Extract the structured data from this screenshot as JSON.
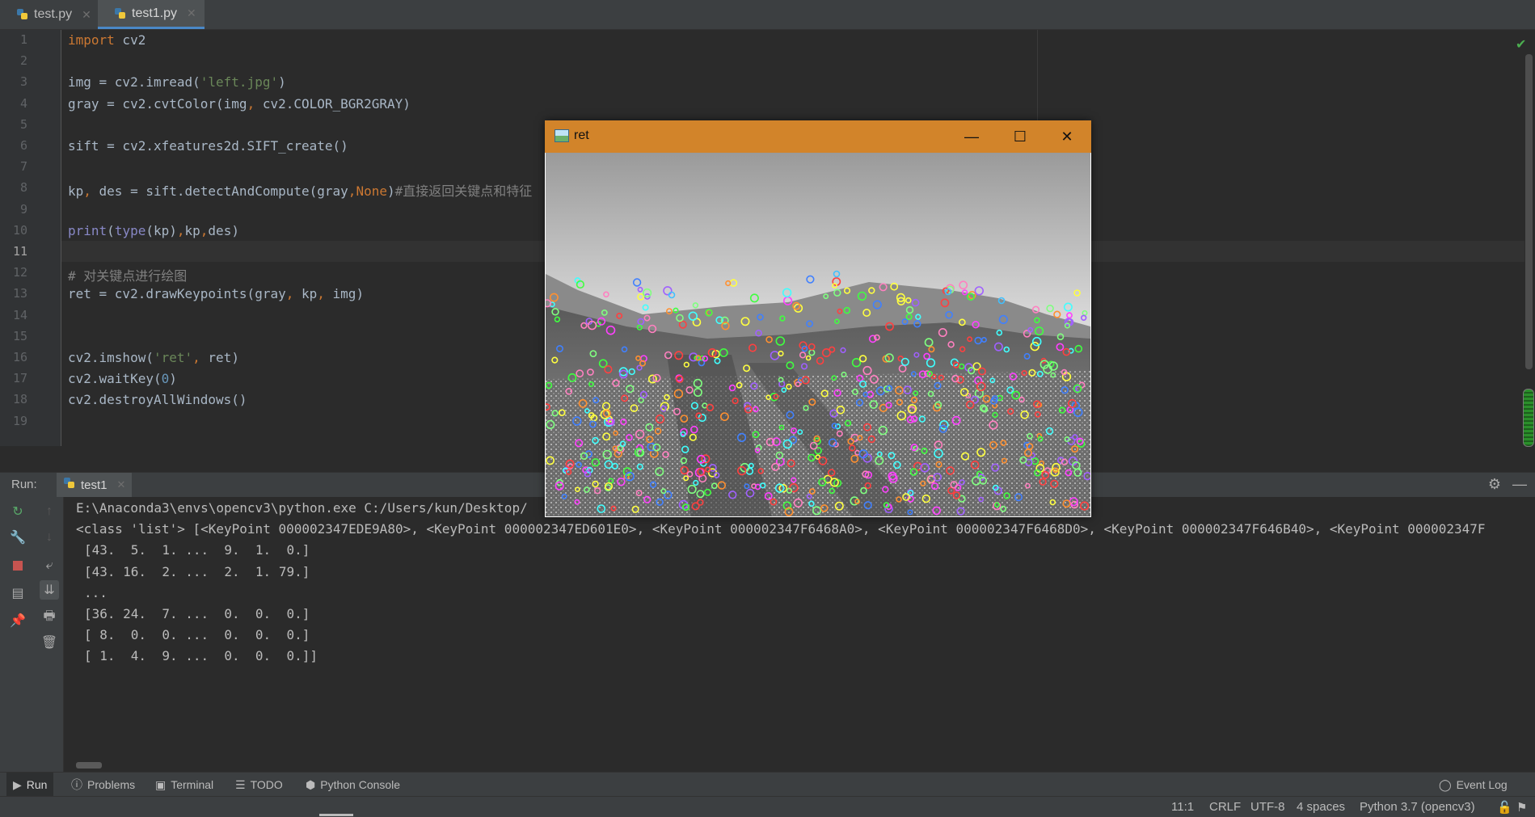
{
  "tabs": [
    {
      "label": "test.py",
      "active": false
    },
    {
      "label": "test1.py",
      "active": true
    }
  ],
  "editor": {
    "current_line": 11,
    "lines": [
      [
        {
          "t": "import",
          "c": "kw"
        },
        {
          "t": " cv2",
          "c": ""
        }
      ],
      [],
      [
        {
          "t": "img = cv2.imread(",
          "c": ""
        },
        {
          "t": "'left.jpg'",
          "c": "str"
        },
        {
          "t": ")",
          "c": ""
        }
      ],
      [
        {
          "t": "gray = cv2.cvtColor(img",
          "c": ""
        },
        {
          "t": ",",
          "c": "kw"
        },
        {
          "t": " cv2.COLOR_BGR2GRAY)",
          "c": ""
        }
      ],
      [],
      [
        {
          "t": "sift = cv2.xfeatures2d.SIFT_create()",
          "c": ""
        }
      ],
      [],
      [
        {
          "t": "kp",
          "c": ""
        },
        {
          "t": ",",
          "c": "kw"
        },
        {
          "t": " des = sift.detectAndCompute(gray",
          "c": ""
        },
        {
          "t": ",",
          "c": "kw"
        },
        {
          "t": "None",
          "c": "kw"
        },
        {
          "t": ")",
          "c": ""
        },
        {
          "t": "#直接返回关键点和特征",
          "c": "cm"
        }
      ],
      [],
      [
        {
          "t": "print",
          "c": "bi"
        },
        {
          "t": "(",
          "c": ""
        },
        {
          "t": "type",
          "c": "bi"
        },
        {
          "t": "(kp)",
          "c": ""
        },
        {
          "t": ",",
          "c": "kw"
        },
        {
          "t": "kp",
          "c": ""
        },
        {
          "t": ",",
          "c": "kw"
        },
        {
          "t": "des)",
          "c": ""
        }
      ],
      [],
      [
        {
          "t": "# 对关键点进行绘图",
          "c": "cm"
        }
      ],
      [
        {
          "t": "ret = cv2.drawKeypoints(gray",
          "c": ""
        },
        {
          "t": ",",
          "c": "kw"
        },
        {
          "t": " kp",
          "c": ""
        },
        {
          "t": ",",
          "c": "kw"
        },
        {
          "t": " img)",
          "c": ""
        }
      ],
      [],
      [],
      [
        {
          "t": "cv2.imshow(",
          "c": ""
        },
        {
          "t": "'ret'",
          "c": "str"
        },
        {
          "t": ",",
          "c": "kw"
        },
        {
          "t": " ret)",
          "c": ""
        }
      ],
      [
        {
          "t": "cv2.waitKey(",
          "c": ""
        },
        {
          "t": "0",
          "c": "num"
        },
        {
          "t": ")",
          "c": ""
        }
      ],
      [
        {
          "t": "cv2.destroyAllWindows()",
          "c": ""
        }
      ],
      []
    ]
  },
  "run": {
    "label": "Run:",
    "tab": "test1",
    "output": [
      "E:\\Anaconda3\\envs\\opencv3\\python.exe C:/Users/kun/Desktop/",
      "<class 'list'> [<KeyPoint 000002347EDE9A80>, <KeyPoint 000002347ED601E0>, <KeyPoint 000002347F6468A0>, <KeyPoint 000002347F6468D0>, <KeyPoint 000002347F646B40>, <KeyPoint 000002347F",
      "[43.  5.  1. ...  9.  1.  0.]",
      "[43. 16.  2. ...  2.  1. 79.]",
      "...",
      "[36. 24.  7. ...  0.  0.  0.]",
      "[ 8.  0.  0. ...  0.  0.  0.]",
      "[ 1.  4.  9. ...  0.  0.  0.]]"
    ]
  },
  "tool_windows": [
    "Run",
    "Problems",
    "Terminal",
    "TODO",
    "Python Console"
  ],
  "event_log": "Event Log",
  "status": {
    "position": "11:1",
    "line_sep": "CRLF",
    "encoding": "UTF-8",
    "indent": "4 spaces",
    "interpreter": "Python 3.7 (opencv3)"
  },
  "image_window": {
    "title": "ret",
    "keypoint_colors": [
      "#ff4040",
      "#40ff40",
      "#4080ff",
      "#ffff40",
      "#ff40ff",
      "#40ffff",
      "#ff9030",
      "#a060ff",
      "#80ff80",
      "#ff80c0"
    ]
  },
  "icons": {
    "python": "python-file-icon",
    "rerun": "rerun-icon",
    "wrench": "wrench-icon",
    "stop": "stop-icon",
    "layout": "layout-icon",
    "pin": "pin-icon",
    "up": "arrow-up-icon",
    "down": "arrow-down-icon",
    "wrap": "soft-wrap-icon",
    "scroll": "scroll-to-end-icon",
    "print": "print-icon",
    "trash": "trash-icon",
    "gear": "gear-icon",
    "minimize": "minimize-icon",
    "lock": "lock-icon",
    "check": "check-icon"
  }
}
